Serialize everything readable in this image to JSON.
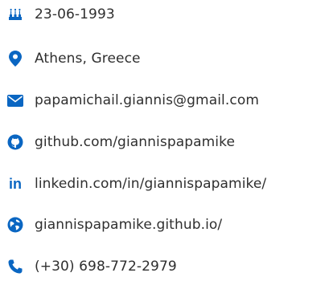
{
  "colors": {
    "accent": "#0a66c2",
    "text": "#2f2f2f"
  },
  "contacts": [
    {
      "icon": "birthday-cake-icon",
      "text": "23-06-1993"
    },
    {
      "icon": "location-pin-icon",
      "text": "Athens, Greece"
    },
    {
      "icon": "envelope-icon",
      "text": "papamichail.giannis@gmail.com"
    },
    {
      "icon": "github-icon",
      "text": "github.com/giannispapamike"
    },
    {
      "icon": "linkedin-icon",
      "text": "linkedin.com/in/giannispapamike/",
      "icon_text": "in"
    },
    {
      "icon": "globe-icon",
      "text": "giannispapamike.github.io/"
    },
    {
      "icon": "phone-icon",
      "text": "(+30) 698-772-2979"
    }
  ]
}
